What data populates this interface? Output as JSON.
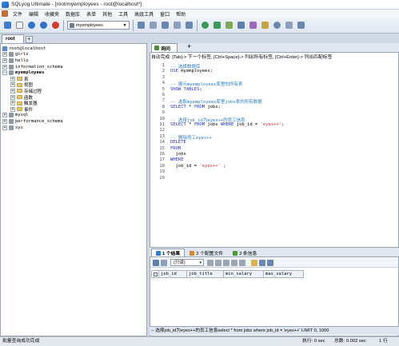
{
  "window": {
    "title": "SQLyog Ultimate - [root/myemployees - root@localhost*]"
  },
  "menu": [
    "文件",
    "编辑",
    "收藏夹",
    "数据库",
    "表单",
    "其他",
    "工具",
    "高级工具",
    "窗口",
    "帮助"
  ],
  "toolbar": {
    "database_selector": "myemployees"
  },
  "connection_tab": {
    "label": "root"
  },
  "tree": {
    "root": "root@localhost",
    "databases": [
      {
        "name": "girls",
        "expanded": false
      },
      {
        "name": "hello",
        "expanded": false
      },
      {
        "name": "information_schema",
        "expanded": false
      },
      {
        "name": "myemployees",
        "expanded": true,
        "bold": true
      },
      {
        "name": "mysql",
        "expanded": false
      },
      {
        "name": "performance_schema",
        "expanded": false
      },
      {
        "name": "sys",
        "expanded": false
      }
    ],
    "myemployees_children": [
      "表",
      "视图",
      "存储过程",
      "函数",
      "触发器",
      "事件"
    ]
  },
  "query_tab": {
    "label": "询问",
    "add": "+"
  },
  "hint": "自动完成: [Tab]-> 下一个标签, [Ctrl+Space]-> 列出所有标签, [Ctrl+Enter]-> 列出匹配标签",
  "code_lines": [
    {
      "n": "1",
      "parts": [
        {
          "t": "-- 选择数据库",
          "c": "cm"
        }
      ]
    },
    {
      "n": "2",
      "parts": [
        {
          "t": "USE",
          "c": "kw"
        },
        {
          "t": " myemployees;",
          "c": ""
        }
      ]
    },
    {
      "n": "3",
      "parts": []
    },
    {
      "n": "4",
      "parts": [
        {
          "t": "-- 展示myemployees库里的所有表",
          "c": "cm"
        }
      ]
    },
    {
      "n": "5",
      "parts": [
        {
          "t": "SHOW TABLES",
          "c": "kw"
        },
        {
          "t": ";",
          "c": ""
        }
      ]
    },
    {
      "n": "6",
      "parts": []
    },
    {
      "n": "7",
      "parts": [
        {
          "t": "-- 选取myemployees库里jobs表的所有数据",
          "c": "cm"
        }
      ]
    },
    {
      "n": "8",
      "parts": [
        {
          "t": "SELECT",
          "c": "kw"
        },
        {
          "t": " * ",
          "c": ""
        },
        {
          "t": "FROM",
          "c": "kw"
        },
        {
          "t": " jobs;",
          "c": ""
        }
      ]
    },
    {
      "n": "9",
      "parts": []
    },
    {
      "n": "10",
      "parts": [
        {
          "t": "-- 选择job_id为eyes++的员工信息",
          "c": "cm"
        }
      ]
    },
    {
      "n": "11",
      "parts": [
        {
          "t": "SELECT",
          "c": "kw"
        },
        {
          "t": " * ",
          "c": ""
        },
        {
          "t": "FROM",
          "c": "kw"
        },
        {
          "t": " jobs ",
          "c": ""
        },
        {
          "t": "WHERE",
          "c": "kw"
        },
        {
          "t": " job_id = ",
          "c": ""
        },
        {
          "t": "'eyes++'",
          "c": "str"
        },
        {
          "t": ";",
          "c": ""
        }
      ]
    },
    {
      "n": "12",
      "parts": []
    },
    {
      "n": "13",
      "parts": [
        {
          "t": "-- 删除员工eyes++",
          "c": "cm"
        }
      ]
    },
    {
      "n": "14",
      "parts": [
        {
          "t": "DELETE",
          "c": "kw"
        }
      ]
    },
    {
      "n": "15",
      "parts": [
        {
          "t": "FROM",
          "c": "kw"
        }
      ]
    },
    {
      "n": "16",
      "parts": [
        {
          "t": "  jobs",
          "c": ""
        }
      ]
    },
    {
      "n": "17",
      "parts": [
        {
          "t": "WHERE",
          "c": "kw"
        }
      ]
    },
    {
      "n": "18",
      "parts": [
        {
          "t": "  job_id = ",
          "c": ""
        },
        {
          "t": "'eyes++'",
          "c": "str"
        },
        {
          "t": " ;",
          "c": ""
        }
      ]
    },
    {
      "n": "19",
      "parts": []
    },
    {
      "n": "20",
      "parts": []
    }
  ],
  "result_tabs": [
    {
      "label": "1 个结果",
      "active": true,
      "color": "#2f7ed8"
    },
    {
      "label": "2 个配置文件",
      "active": false,
      "color": "#d68a2a"
    },
    {
      "label": "3 条信息",
      "active": false,
      "color": "#4a9a3c"
    }
  ],
  "result_toolbar": {
    "mode": "(只读)"
  },
  "grid_headers": [
    "job_id",
    "job_title",
    "min_salary",
    "max_salary"
  ],
  "status_query": "-- 选择job_id为eyes++的员工信息select * from jobs where job_id = 'eyes++' LIMIT 0, 1000",
  "status": {
    "left": "批量查询成功完成",
    "exec": "执行: 0 sec",
    "total": "总数: 0.002 sec",
    "rows": "1 行"
  }
}
